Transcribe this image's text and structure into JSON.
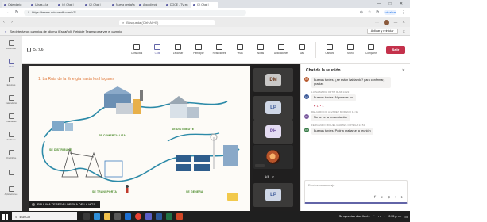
{
  "browser": {
    "tabs": [
      {
        "label": "Calendario: ",
        "active": false
      },
      {
        "label": "Ulises a la ",
        "active": false
      },
      {
        "label": "(4) Chat | ",
        "active": false
      },
      {
        "label": "(2) Chat | ",
        "active": false
      },
      {
        "label": "Nueva pestaña",
        "active": false
      },
      {
        "label": "Algo directo",
        "active": false
      },
      {
        "label": "DOCE - TV en",
        "active": false
      },
      {
        "label": "(3) Chat | ",
        "active": true
      }
    ],
    "window_controls": {
      "minimize": "—",
      "maximize": "□",
      "close": "✕"
    },
    "url": "https://teams.microsoft.com/v2/",
    "profile_label": "Actualizar"
  },
  "teams_header": {
    "search_placeholder": "Búsqueda (Ctrl+Alt+E)",
    "more": "···"
  },
  "banner": {
    "message": "Se detectaron cambios de idioma (Español). Reinicie Teams para ver el cambio.",
    "action_label": "Aplicar y reiniciar",
    "close": "✕"
  },
  "rail": {
    "items": [
      {
        "label": "Actividad"
      },
      {
        "label": "Chat"
      },
      {
        "label": "Equipos"
      },
      {
        "label": "Calendario"
      },
      {
        "label": "Llamadas"
      },
      {
        "label": "Archivos"
      },
      {
        "label": "OneDrive"
      },
      {
        "label": ""
      },
      {
        "label": "Aplicaciones"
      }
    ]
  },
  "meeting": {
    "timer": "57:06",
    "tools": [
      {
        "label": "Contactos",
        "icon": "people-icon",
        "selected": false
      },
      {
        "label": "Chat",
        "icon": "chat-icon",
        "selected": true
      },
      {
        "label": "Levantar",
        "icon": "raise-hand-icon",
        "selected": false
      },
      {
        "label": "Participar",
        "icon": "participants-icon",
        "selected": false
      },
      {
        "label": "Reacciones",
        "icon": "smile-icon",
        "selected": false
      },
      {
        "label": "Vista",
        "icon": "grid-icon",
        "selected": false
      },
      {
        "label": "Notas",
        "icon": "notes-icon",
        "selected": false
      },
      {
        "label": "Aplicaciones",
        "icon": "apps-icon",
        "selected": false
      },
      {
        "label": "Más",
        "icon": "more-icon",
        "selected": false
      }
    ],
    "media": [
      {
        "label": "Cámara",
        "icon": "camera-icon"
      },
      {
        "label": "Micro",
        "icon": "mic-icon"
      },
      {
        "label": "Compartir",
        "icon": "share-icon"
      }
    ],
    "leave_label": "Salir"
  },
  "slide": {
    "title": "1. La Ruta de la Energía hasta los Hogares",
    "labels": {
      "distribuye": "SE DISTRIBUYE",
      "distribuye2": "SE DISTRIBUYE",
      "comercializa": "SE COMERCIALIZA",
      "transporta": "SE TRANSPORTA",
      "genera": "SE GENERA"
    },
    "presenter": "PAULINA TERESA LORENA DE LA HOZ"
  },
  "videos": {
    "tiles": [
      {
        "initials": "DM",
        "bg": "#c9c8c7",
        "fg": "#6b3a1f"
      },
      {
        "initials": "LP",
        "bg": "#cfd7e6",
        "fg": "#3b5998"
      },
      {
        "initials": "PH",
        "bg": "#e4dcf2",
        "fg": "#6a4c9c"
      },
      {
        "initials": "",
        "photo": true
      },
      {
        "initials": "LP",
        "bg": "#cfd7e6",
        "fg": "#3b5998"
      }
    ],
    "pager": {
      "current": "1/4",
      "next": ">"
    }
  },
  "chat": {
    "title": "Chat de la reunión",
    "messages": [
      {
        "meta": "",
        "text": "Buenas tardes, ¿se están hablando? para confirmar, gracias",
        "initials": "DM",
        "color": "#b6562a"
      },
      {
        "meta": "LUISA MARIA ORTIZ RUIZ  14:22",
        "text": "Buenas tardes. Al parecer no.",
        "initials": "LO",
        "color": "#3b5998"
      },
      {
        "meta": "",
        "reacts": "♥ 1  ◔ 1"
      },
      {
        "meta": "DELIA ROCIO ALVAREZ MORENO  14:32",
        "text": "No se ve la presentación",
        "initials": "DA",
        "color": "#7a5a9e"
      },
      {
        "meta": "FERNANDO MIGUEL MARTES ORTEGA  14:53",
        "text": "Buenas tardes. Podría grabarse la reunión",
        "initials": "FM",
        "color": "#3b7d4a"
      }
    ],
    "compose_placeholder": "Escriba un mensaje"
  },
  "taskbar": {
    "search_placeholder": "Buscar",
    "tray_text": "Se aprecian días lluvi...",
    "time": "2:55 p. m.",
    "date": ""
  }
}
